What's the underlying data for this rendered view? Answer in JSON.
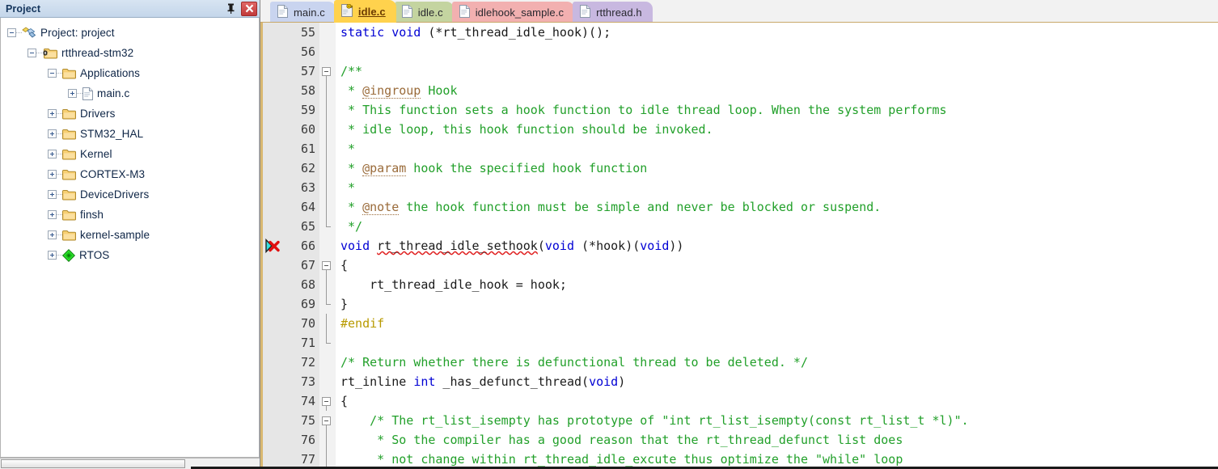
{
  "panel": {
    "title": "Project",
    "pin_icon": "pin-icon",
    "close_icon": "close-icon",
    "tree": [
      {
        "label": "Project: project",
        "depth": 0,
        "toggle": "minus",
        "icon": "project-icon"
      },
      {
        "label": "rtthread-stm32",
        "depth": 1,
        "toggle": "minus",
        "icon": "target-folder-icon"
      },
      {
        "label": "Applications",
        "depth": 2,
        "toggle": "minus",
        "icon": "folder-open-icon"
      },
      {
        "label": "main.c",
        "depth": 3,
        "toggle": "plus",
        "icon": "c-file-icon"
      },
      {
        "label": "Drivers",
        "depth": 2,
        "toggle": "plus",
        "icon": "folder-icon"
      },
      {
        "label": "STM32_HAL",
        "depth": 2,
        "toggle": "plus",
        "icon": "folder-icon"
      },
      {
        "label": "Kernel",
        "depth": 2,
        "toggle": "plus",
        "icon": "folder-icon"
      },
      {
        "label": "CORTEX-M3",
        "depth": 2,
        "toggle": "plus",
        "icon": "folder-icon"
      },
      {
        "label": "DeviceDrivers",
        "depth": 2,
        "toggle": "plus",
        "icon": "folder-icon"
      },
      {
        "label": "finsh",
        "depth": 2,
        "toggle": "plus",
        "icon": "folder-icon"
      },
      {
        "label": "kernel-sample",
        "depth": 2,
        "toggle": "plus",
        "icon": "folder-icon"
      },
      {
        "label": "RTOS",
        "depth": 2,
        "toggle": "plus",
        "icon": "rtos-green-diamond-icon"
      }
    ]
  },
  "tabs": [
    {
      "label": "main.c",
      "color": "#c9d4ef",
      "icon": "file-icon",
      "active": false
    },
    {
      "label": "idle.c",
      "color": "#ffd24d",
      "icon": "readonly-key-icon",
      "active": true
    },
    {
      "label": "idle.c",
      "color": "#c4d4a0",
      "icon": "file-icon",
      "active": false
    },
    {
      "label": "idlehook_sample.c",
      "color": "#f2b0b0",
      "icon": "file-icon",
      "active": false
    },
    {
      "label": "rtthread.h",
      "color": "#c8b8e0",
      "icon": "file-icon",
      "active": false
    }
  ],
  "editor": {
    "first_line": 55,
    "error_marker_line": 66,
    "error_marker_icon": "error-x-icon",
    "lines": [
      {
        "n": 55,
        "fold": "none",
        "tokens": [
          {
            "t": "static void ",
            "c": "kw"
          },
          {
            "t": "(*rt_thread_idle_hook)();",
            "c": "plain"
          }
        ]
      },
      {
        "n": 56,
        "fold": "none",
        "tokens": []
      },
      {
        "n": 57,
        "fold": "start",
        "tokens": [
          {
            "t": "/**",
            "c": "cmt"
          }
        ]
      },
      {
        "n": 58,
        "fold": "mid",
        "tokens": [
          {
            "t": " * ",
            "c": "cmt"
          },
          {
            "t": "@ingroup",
            "c": "dox"
          },
          {
            "t": " Hook",
            "c": "cmt"
          }
        ]
      },
      {
        "n": 59,
        "fold": "mid",
        "tokens": [
          {
            "t": " * This function sets a hook function to idle thread loop. When the system performs",
            "c": "cmt"
          }
        ]
      },
      {
        "n": 60,
        "fold": "mid",
        "tokens": [
          {
            "t": " * idle loop, this hook function should be invoked.",
            "c": "cmt"
          }
        ]
      },
      {
        "n": 61,
        "fold": "mid",
        "tokens": [
          {
            "t": " *",
            "c": "cmt"
          }
        ]
      },
      {
        "n": 62,
        "fold": "mid",
        "tokens": [
          {
            "t": " * ",
            "c": "cmt"
          },
          {
            "t": "@param",
            "c": "dox"
          },
          {
            "t": " hook the specified hook function",
            "c": "cmt"
          }
        ]
      },
      {
        "n": 63,
        "fold": "mid",
        "tokens": [
          {
            "t": " *",
            "c": "cmt"
          }
        ]
      },
      {
        "n": 64,
        "fold": "mid",
        "tokens": [
          {
            "t": " * ",
            "c": "cmt"
          },
          {
            "t": "@note",
            "c": "dox"
          },
          {
            "t": " the hook function must be simple and never be blocked or suspend.",
            "c": "cmt"
          }
        ]
      },
      {
        "n": 65,
        "fold": "end",
        "tokens": [
          {
            "t": " */",
            "c": "cmt"
          }
        ]
      },
      {
        "n": 66,
        "fold": "none",
        "tokens": [
          {
            "t": "void ",
            "c": "kw"
          },
          {
            "t": "rt_thread_idle_sethook",
            "c": "plain err"
          },
          {
            "t": "(",
            "c": "plain"
          },
          {
            "t": "void",
            "c": "kw"
          },
          {
            "t": " (*hook)(",
            "c": "plain"
          },
          {
            "t": "void",
            "c": "kw"
          },
          {
            "t": "))",
            "c": "plain"
          }
        ]
      },
      {
        "n": 67,
        "fold": "start",
        "tokens": [
          {
            "t": "{",
            "c": "plain"
          }
        ]
      },
      {
        "n": 68,
        "fold": "mid",
        "tokens": [
          {
            "t": "    rt_thread_idle_hook = hook;",
            "c": "plain"
          }
        ]
      },
      {
        "n": 69,
        "fold": "end",
        "tokens": [
          {
            "t": "}",
            "c": "plain"
          }
        ]
      },
      {
        "n": 70,
        "fold": "mid2",
        "tokens": [
          {
            "t": "#endif",
            "c": "pre"
          }
        ]
      },
      {
        "n": 71,
        "fold": "end2",
        "tokens": []
      },
      {
        "n": 72,
        "fold": "none",
        "tokens": [
          {
            "t": "/* Return whether there is defunctional thread to be deleted. */",
            "c": "cmt"
          }
        ]
      },
      {
        "n": 73,
        "fold": "none",
        "tokens": [
          {
            "t": "rt_inline ",
            "c": "plain"
          },
          {
            "t": "int",
            "c": "kw"
          },
          {
            "t": " _has_defunct_thread(",
            "c": "plain"
          },
          {
            "t": "void",
            "c": "kw"
          },
          {
            "t": ")",
            "c": "plain"
          }
        ]
      },
      {
        "n": 74,
        "fold": "start",
        "tokens": [
          {
            "t": "{",
            "c": "plain"
          }
        ]
      },
      {
        "n": 75,
        "fold": "start2",
        "tokens": [
          {
            "t": "    /* The rt_list_isempty has prototype of \"int rt_list_isempty(const rt_list_t *l)\".",
            "c": "cmt"
          }
        ]
      },
      {
        "n": 76,
        "fold": "mid",
        "tokens": [
          {
            "t": "     * So the compiler has a good reason that the rt_thread_defunct list does",
            "c": "cmt"
          }
        ]
      },
      {
        "n": 77,
        "fold": "mid",
        "tokens": [
          {
            "t": "     * not change within rt_thread_idle_excute thus optimize the \"while\" loop",
            "c": "cmt"
          }
        ]
      }
    ]
  }
}
